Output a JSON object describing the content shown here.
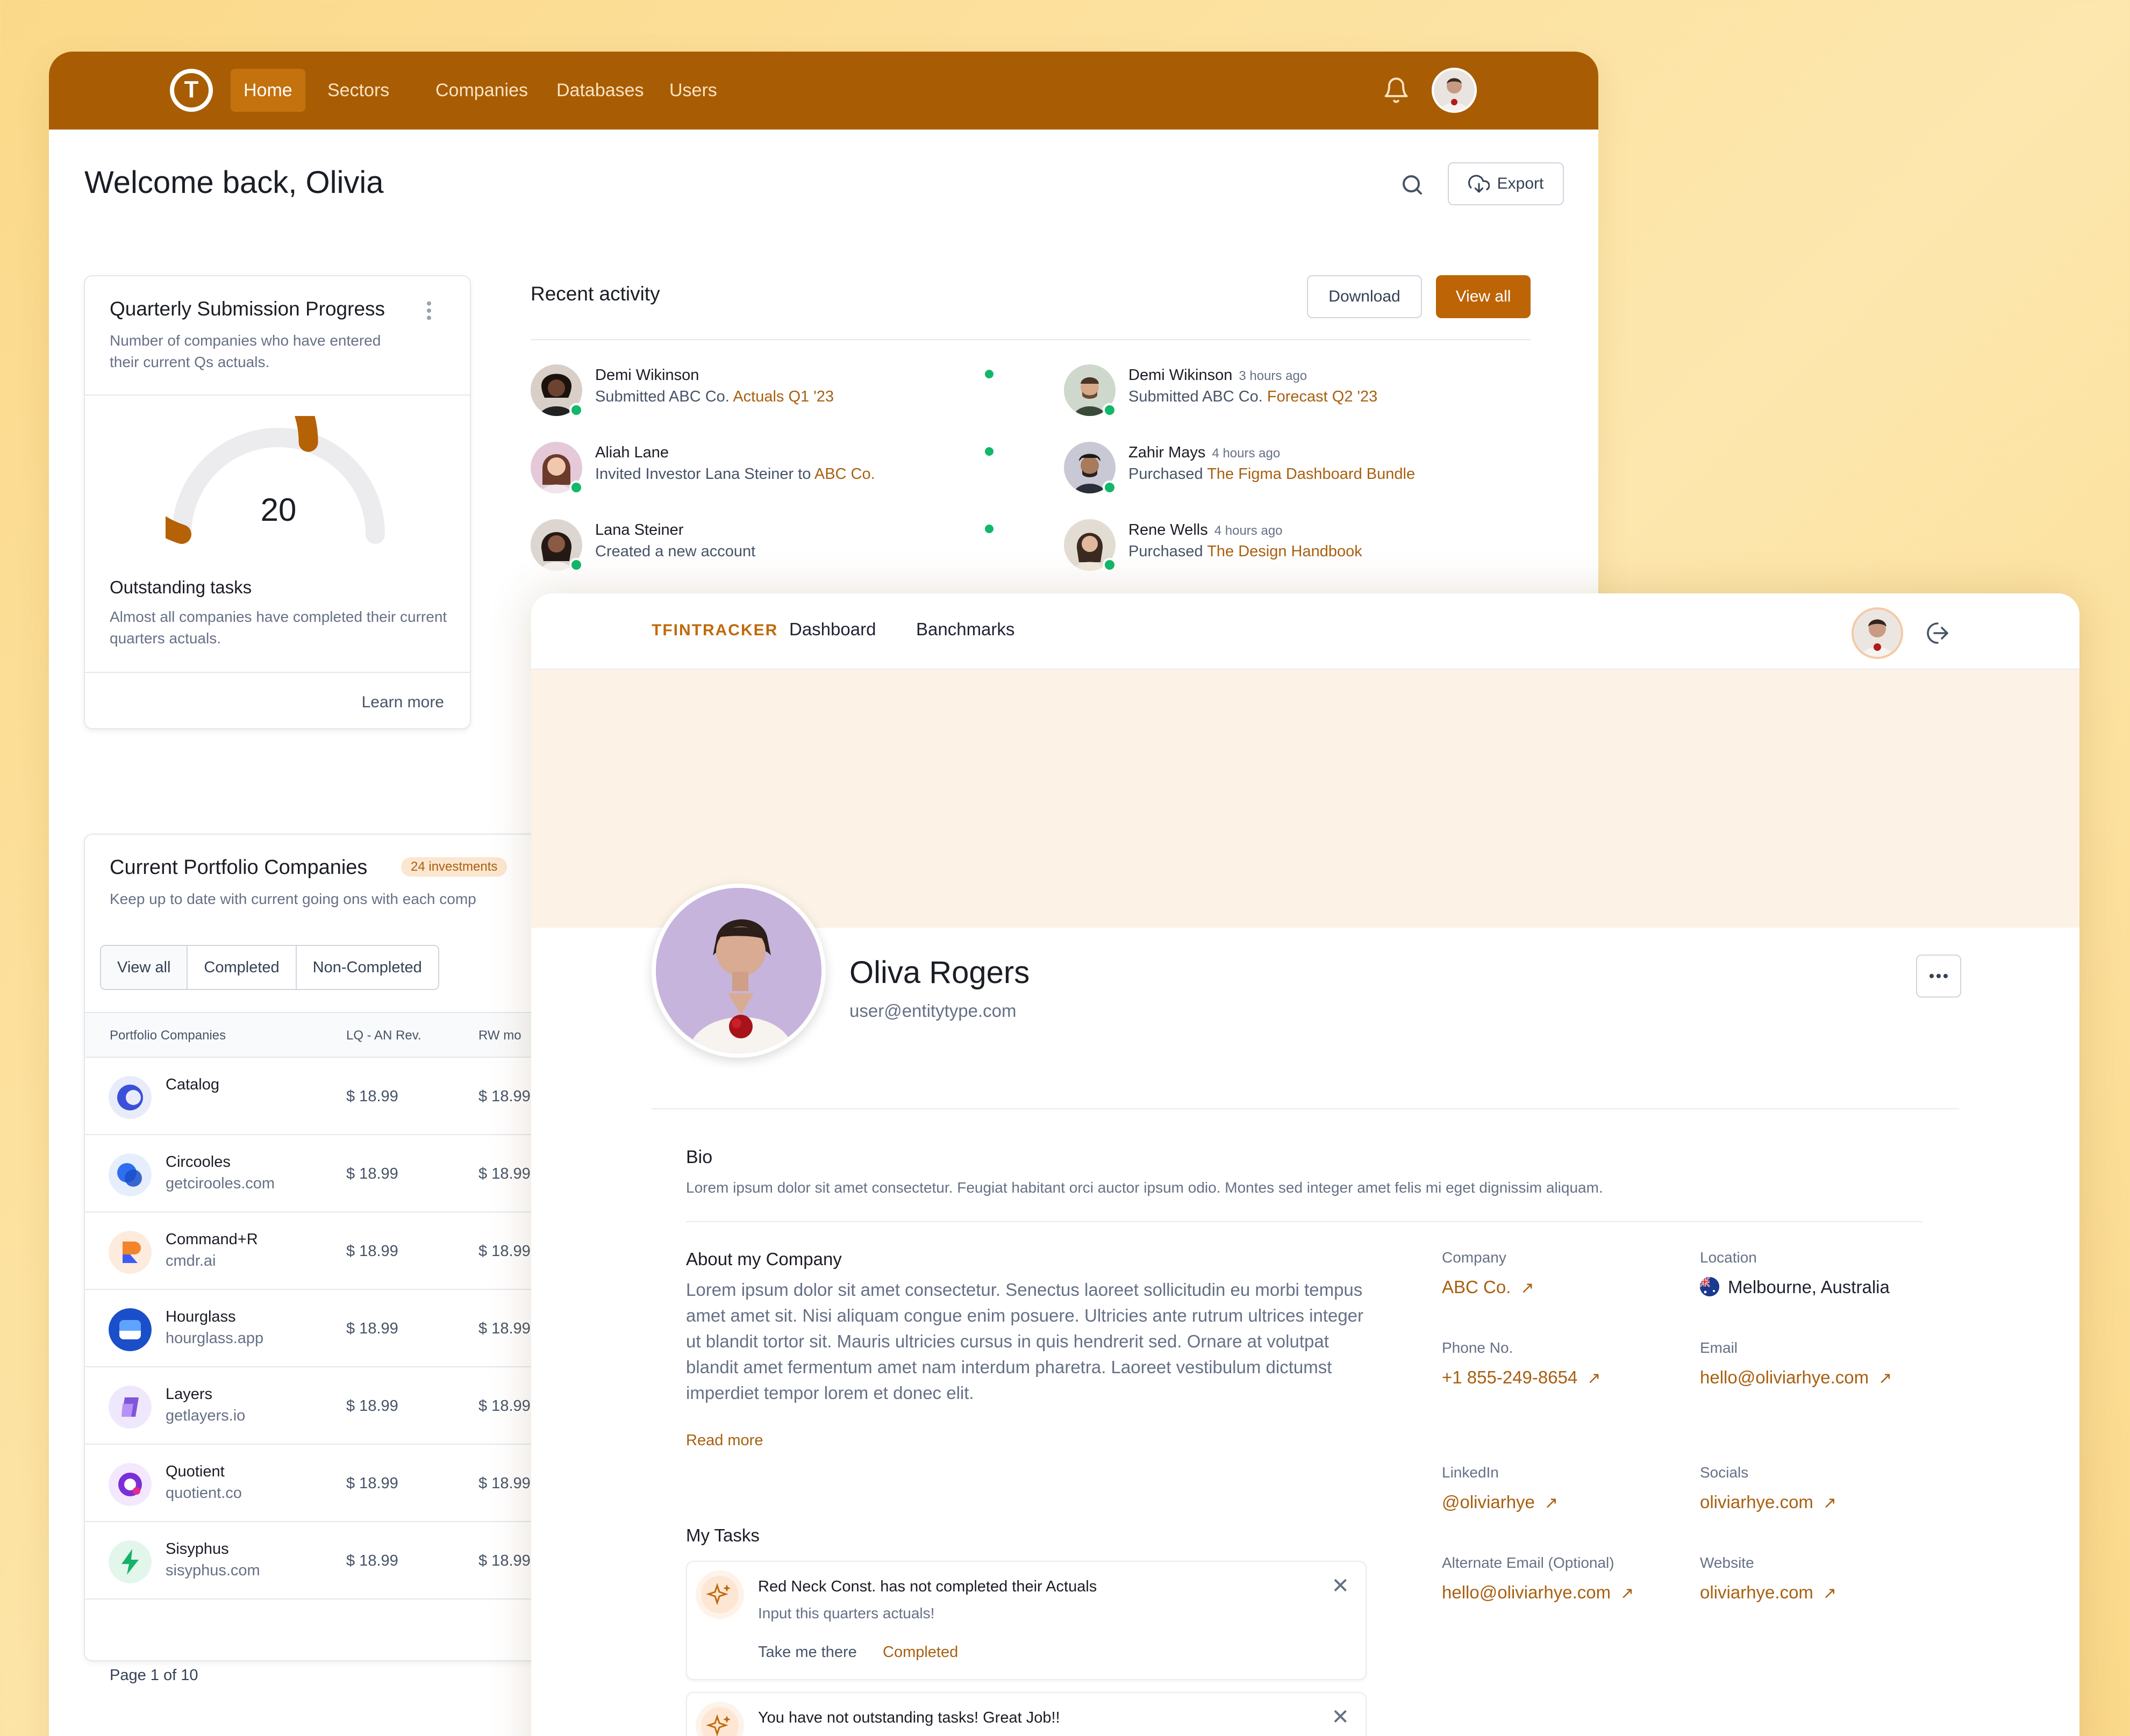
{
  "dashboard": {
    "nav": {
      "logo_letter": "T",
      "items": [
        "Home",
        "Sectors",
        "Companies",
        "Databases",
        "Users"
      ],
      "active": "Home"
    },
    "welcome": "Welcome back, Olivia",
    "export_label": "Export",
    "progress_card": {
      "title": "Quarterly Submission Progress",
      "description": "Number of companies who have entered their current Qs actuals.",
      "gauge_value": "20",
      "gauge_fraction": 0.6,
      "outstanding_title": "Outstanding tasks",
      "outstanding_desc": "Almost all companies have completed their current quarters actuals.",
      "learn_more": "Learn more"
    },
    "recent_activity": {
      "title": "Recent activity",
      "download_label": "Download",
      "view_all_label": "View all",
      "left": [
        {
          "name": "Demi Wikinson",
          "pre": "Submitted ABC Co. ",
          "link": "Actuals Q1 '23"
        },
        {
          "name": "Aliah Lane",
          "pre": "Invited Investor Lana Steiner to ",
          "link": "ABC Co."
        },
        {
          "name": "Lana Steiner",
          "pre": "Created a new account",
          "link": ""
        }
      ],
      "right": [
        {
          "name": "Demi Wikinson",
          "time": "3 hours ago",
          "pre": "Submitted ABC Co. ",
          "link": "Forecast Q2 '23"
        },
        {
          "name": "Zahir Mays",
          "time": "4 hours ago",
          "pre": "Purchased ",
          "link": "The Figma Dashboard Bundle"
        },
        {
          "name": "Rene Wells",
          "time": "4 hours ago",
          "pre": "Purchased ",
          "link": "The Design Handbook"
        }
      ]
    },
    "portfolio": {
      "title": "Current Portfolio Companies",
      "badge": "24 investments",
      "description": "Keep up to date with current going ons with each comp",
      "tabs": [
        "View all",
        "Completed",
        "Non-Completed"
      ],
      "columns": [
        "Portfolio Companies",
        "LQ - AN Rev.",
        "RW mo"
      ],
      "rows": [
        {
          "name": "Catalog",
          "site": "",
          "v1": "$ 18.99",
          "v2": "$ 18.99"
        },
        {
          "name": "Circooles",
          "site": "getcirooles.com",
          "v1": "$ 18.99",
          "v2": "$ 18.99"
        },
        {
          "name": "Command+R",
          "site": "cmdr.ai",
          "v1": "$ 18.99",
          "v2": "$ 18.99"
        },
        {
          "name": "Hourglass",
          "site": "hourglass.app",
          "v1": "$ 18.99",
          "v2": "$ 18.99"
        },
        {
          "name": "Layers",
          "site": "getlayers.io",
          "v1": "$ 18.99",
          "v2": "$ 18.99"
        },
        {
          "name": "Quotient",
          "site": "quotient.co",
          "v1": "$ 18.99",
          "v2": "$ 18.99"
        },
        {
          "name": "Sisyphus",
          "site": "sisyphus.com",
          "v1": "$ 18.99",
          "v2": "$ 18.99"
        }
      ],
      "pagination": "Page 1 of 10"
    }
  },
  "profile": {
    "brand": "TFINTRACKER",
    "nav": [
      "Dashboard",
      "Banchmarks"
    ],
    "name": "Oliva Rogers",
    "email": "user@entitytype.com",
    "bio_title": "Bio",
    "bio_text": "Lorem ipsum dolor sit amet consectetur. Feugiat habitant orci auctor ipsum odio. Montes sed integer amet felis mi eget dignissim aliquam.",
    "about_title": "About my Company",
    "about_text": "Lorem ipsum dolor sit amet consectetur. Senectus laoreet sollicitudin eu morbi tempus amet amet sit. Nisi aliquam congue enim posuere. Ultricies ante rutrum ultrices integer ut blandit tortor sit. Mauris ultricies cursus in quis hendrerit sed. Ornare at volutpat blandit amet fermentum amet nam interdum pharetra. Laoreet vestibulum dictumst imperdiet tempor lorem et donec elit.",
    "read_more": "Read more",
    "info": {
      "company_label": "Company",
      "company": "ABC Co.",
      "location_label": "Location",
      "location": "Melbourne, Australia",
      "phone_label": "Phone No.",
      "phone": "+1 855-249-8654",
      "email_label": "Email",
      "email": "hello@oliviarhye.com",
      "linkedin_label": "LinkedIn",
      "linkedin": "@oliviarhye",
      "socials_label": "Socials",
      "socials": "oliviarhye.com",
      "alt_email_label": "Alternate Email (Optional)",
      "alt_email": "hello@oliviarhye.com",
      "website_label": "Website",
      "website": "oliviarhye.com"
    },
    "tasks_title": "My Tasks",
    "tasks": [
      {
        "title": "Red Neck Const. has not completed their Actuals",
        "desc": "Input this quarters actuals!",
        "action1": "Take me there",
        "action2": "Completed"
      },
      {
        "title": "You have not outstanding tasks! Great Job!!",
        "desc": "",
        "action1": "",
        "action2": ""
      }
    ]
  },
  "colors": {
    "accent": "#a85d04",
    "button": "#bc6406",
    "cover": "#fdf2e6",
    "online": "#12b76a"
  }
}
